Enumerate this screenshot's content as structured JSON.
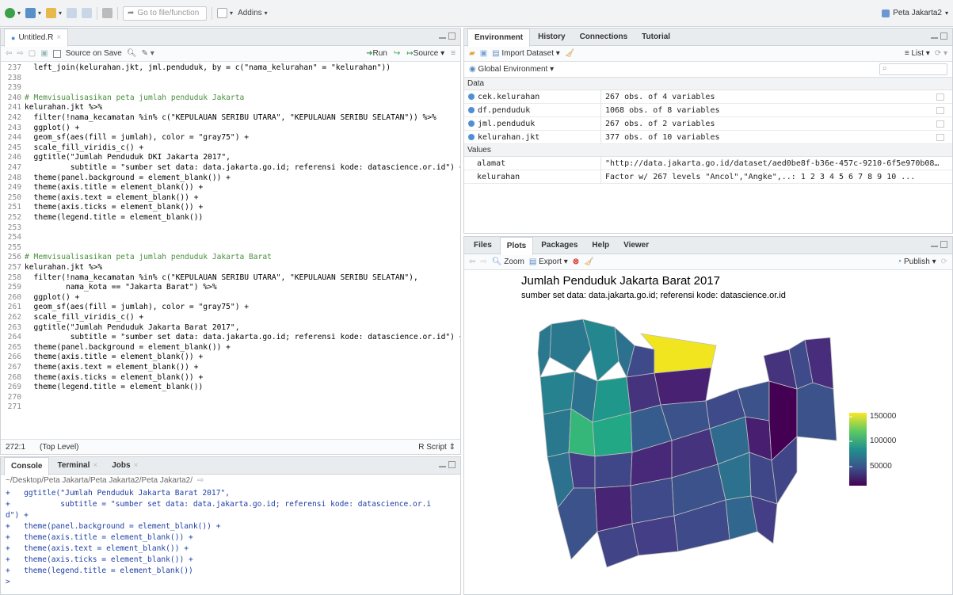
{
  "topbar": {
    "goto_placeholder": "Go to file/function",
    "addins_label": "Addins",
    "project_name": "Peta Jakarta2"
  },
  "editor": {
    "tab_title": "Untitled.R",
    "source_on_save": "Source on Save",
    "run_label": "Run",
    "source_label": "Source",
    "status_position": "272:1",
    "status_scope": "(Top Level)",
    "status_filetype": "R Script",
    "lines": [
      {
        "n": "237",
        "t": "  left_join(kelurahan.jkt, jml.penduduk, by = c(\"nama_kelurahan\" = \"kelurahan\"))",
        "k": "code"
      },
      {
        "n": "238",
        "t": "",
        "k": "code"
      },
      {
        "n": "239",
        "t": "",
        "k": "code"
      },
      {
        "n": "240",
        "t": "# Memvisualisasikan peta jumlah penduduk Jakarta",
        "k": "comment"
      },
      {
        "n": "241",
        "t": "kelurahan.jkt %>%",
        "k": "code"
      },
      {
        "n": "242",
        "t": "  filter(!nama_kecamatan %in% c(\"KEPULAUAN SERIBU UTARA\", \"KEPULAUAN SERIBU SELATAN\")) %>%",
        "k": "code"
      },
      {
        "n": "243",
        "t": "  ggplot() +",
        "k": "code"
      },
      {
        "n": "244",
        "t": "  geom_sf(aes(fill = jumlah), color = \"gray75\") +",
        "k": "code"
      },
      {
        "n": "245",
        "t": "  scale_fill_viridis_c() +",
        "k": "code"
      },
      {
        "n": "246",
        "t": "  ggtitle(\"Jumlah Penduduk DKI Jakarta 2017\",",
        "k": "code"
      },
      {
        "n": "247",
        "t": "          subtitle = \"sumber set data: data.jakarta.go.id; referensi kode: datascience.or.id\") +",
        "k": "code"
      },
      {
        "n": "248",
        "t": "  theme(panel.background = element_blank()) +",
        "k": "code"
      },
      {
        "n": "249",
        "t": "  theme(axis.title = element_blank()) +",
        "k": "code"
      },
      {
        "n": "250",
        "t": "  theme(axis.text = element_blank()) +",
        "k": "code"
      },
      {
        "n": "251",
        "t": "  theme(axis.ticks = element_blank()) +",
        "k": "code"
      },
      {
        "n": "252",
        "t": "  theme(legend.title = element_blank())",
        "k": "code"
      },
      {
        "n": "253",
        "t": "",
        "k": "code"
      },
      {
        "n": "254",
        "t": "",
        "k": "code"
      },
      {
        "n": "255",
        "t": "",
        "k": "code"
      },
      {
        "n": "256",
        "t": "# Memvisualisasikan peta jumlah penduduk Jakarta Barat",
        "k": "comment"
      },
      {
        "n": "257",
        "t": "kelurahan.jkt %>%",
        "k": "code"
      },
      {
        "n": "258",
        "t": "  filter(!nama_kecamatan %in% c(\"KEPULAUAN SERIBU UTARA\", \"KEPULAUAN SERIBU SELATAN\"),",
        "k": "code"
      },
      {
        "n": "259",
        "t": "         nama_kota == \"Jakarta Barat\") %>%",
        "k": "code"
      },
      {
        "n": "260",
        "t": "  ggplot() +",
        "k": "code"
      },
      {
        "n": "261",
        "t": "  geom_sf(aes(fill = jumlah), color = \"gray75\") +",
        "k": "code"
      },
      {
        "n": "262",
        "t": "  scale_fill_viridis_c() +",
        "k": "code"
      },
      {
        "n": "263",
        "t": "  ggtitle(\"Jumlah Penduduk Jakarta Barat 2017\",",
        "k": "code"
      },
      {
        "n": "264",
        "t": "          subtitle = \"sumber set data: data.jakarta.go.id; referensi kode: datascience.or.id\") +",
        "k": "code"
      },
      {
        "n": "265",
        "t": "  theme(panel.background = element_blank()) +",
        "k": "code"
      },
      {
        "n": "266",
        "t": "  theme(axis.title = element_blank()) +",
        "k": "code"
      },
      {
        "n": "267",
        "t": "  theme(axis.text = element_blank()) +",
        "k": "code"
      },
      {
        "n": "268",
        "t": "  theme(axis.ticks = element_blank()) +",
        "k": "code"
      },
      {
        "n": "269",
        "t": "  theme(legend.title = element_blank())",
        "k": "code"
      },
      {
        "n": "270",
        "t": "",
        "k": "code"
      },
      {
        "n": "271",
        "t": "",
        "k": "code"
      }
    ]
  },
  "console": {
    "tabs": [
      "Console",
      "Terminal",
      "Jobs"
    ],
    "path": "~/Desktop/Peta Jakarta/Peta Jakarta2/Peta Jakarta2/",
    "lines": [
      "+   ggtitle(\"Jumlah Penduduk Jakarta Barat 2017\",",
      "+           subtitle = \"sumber set data: data.jakarta.go.id; referensi kode: datascience.or.i",
      "d\") +",
      "+   theme(panel.background = element_blank()) +",
      "+   theme(axis.title = element_blank()) +",
      "+   theme(axis.text = element_blank()) +",
      "+   theme(axis.ticks = element_blank()) +",
      "+   theme(legend.title = element_blank())",
      ">"
    ]
  },
  "environment": {
    "tabs": [
      "Environment",
      "History",
      "Connections",
      "Tutorial"
    ],
    "import_label": "Import Dataset",
    "list_label": "List",
    "scope_label": "Global Environment",
    "data_header": "Data",
    "values_header": "Values",
    "data": [
      {
        "name": "cek.kelurahan",
        "value": "267 obs. of 4 variables"
      },
      {
        "name": "df.penduduk",
        "value": "1068 obs. of 8 variables"
      },
      {
        "name": "jml.penduduk",
        "value": "267 obs. of 2 variables"
      },
      {
        "name": "kelurahan.jkt",
        "value": "377 obs. of 10 variables"
      }
    ],
    "values": [
      {
        "name": "alamat",
        "value": "\"http://data.jakarta.go.id/dataset/aed0be8f-b36e-457c-9210-6f5e970b08…"
      },
      {
        "name": "kelurahan",
        "value": "Factor w/ 267 levels \"Ancol\",\"Angke\",..: 1 2 3 4 5 6 7 8 9 10 ..."
      }
    ]
  },
  "plots": {
    "tabs": [
      "Files",
      "Plots",
      "Packages",
      "Help",
      "Viewer"
    ],
    "zoom_label": "Zoom",
    "export_label": "Export",
    "publish_label": "Publish",
    "title": "Jumlah Penduduk Jakarta Barat 2017",
    "subtitle": "sumber set data: data.jakarta.go.id; referensi kode: datascience.or.id",
    "legend_ticks": [
      "150000",
      "100000",
      "50000"
    ]
  }
}
